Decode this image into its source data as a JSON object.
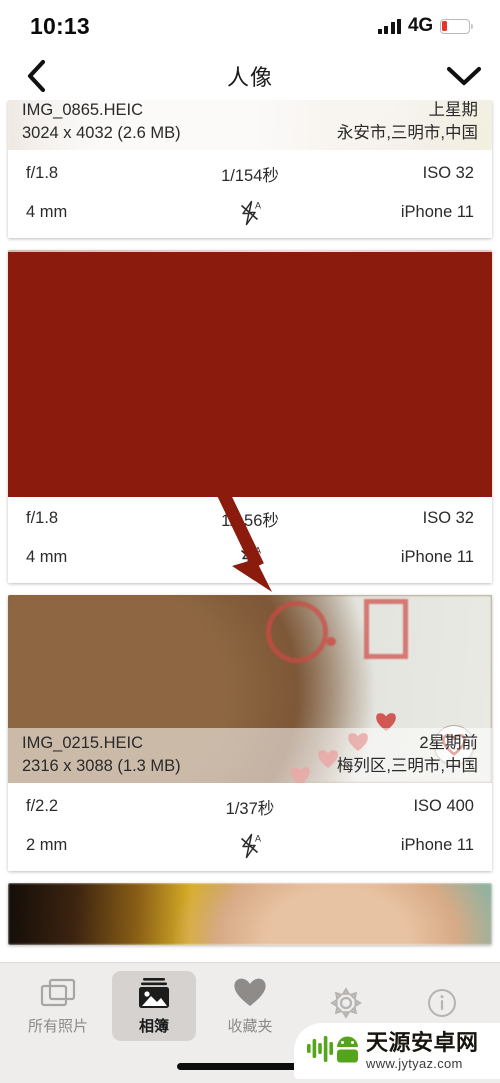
{
  "status_bar": {
    "time": "10:13",
    "network": "4G",
    "signal_bars": 4,
    "battery_percent": 20,
    "battery_color": "#e8332a"
  },
  "nav": {
    "back_icon": "chevron-left-icon",
    "title": "人像",
    "expand_icon": "chevron-down-icon"
  },
  "annotation": {
    "redbox_color": "#8a1b0d",
    "arrow_color": "#8a1b0d"
  },
  "photos": [
    {
      "filename": "IMG_0865.HEIC",
      "dimensions": "3024 x 4032 (2.6 MB)",
      "date": "上星期",
      "location": "永安市,三明市,中国",
      "aperture": "f/1.8",
      "shutter": "1/154秒",
      "iso": "ISO 32",
      "focal": "4 mm",
      "flash_icon": "flash-auto-off-icon",
      "device": "iPhone 11"
    },
    {
      "aperture": "f/1.8",
      "shutter": "1/156秒",
      "iso": "ISO 32",
      "focal": "4 mm",
      "flash_icon": "flash-auto-off-icon",
      "device": "iPhone 11"
    },
    {
      "filename": "IMG_0215.HEIC",
      "dimensions": "2316 x 3088 (1.3 MB)",
      "date": "2星期前",
      "location": "梅列区,三明市,中国",
      "aperture": "f/2.2",
      "shutter": "1/37秒",
      "iso": "ISO 400",
      "focal": "2 mm",
      "flash_icon": "flash-auto-off-icon",
      "device": "iPhone 11",
      "favorite_icon": "heart-outline-icon"
    }
  ],
  "tabbar": {
    "items": [
      {
        "icon": "photos-stack-icon",
        "label": "所有照片",
        "active": false
      },
      {
        "icon": "album-image-icon",
        "label": "相簿",
        "active": true
      },
      {
        "icon": "heart-filled-icon",
        "label": "收藏夹",
        "active": false
      },
      {
        "icon": "gear-icon",
        "label": "",
        "active": false
      },
      {
        "icon": "info-circle-icon",
        "label": "",
        "active": false
      }
    ]
  },
  "watermark": {
    "name": "天源安卓网",
    "url": "www.jytyaz.com"
  }
}
